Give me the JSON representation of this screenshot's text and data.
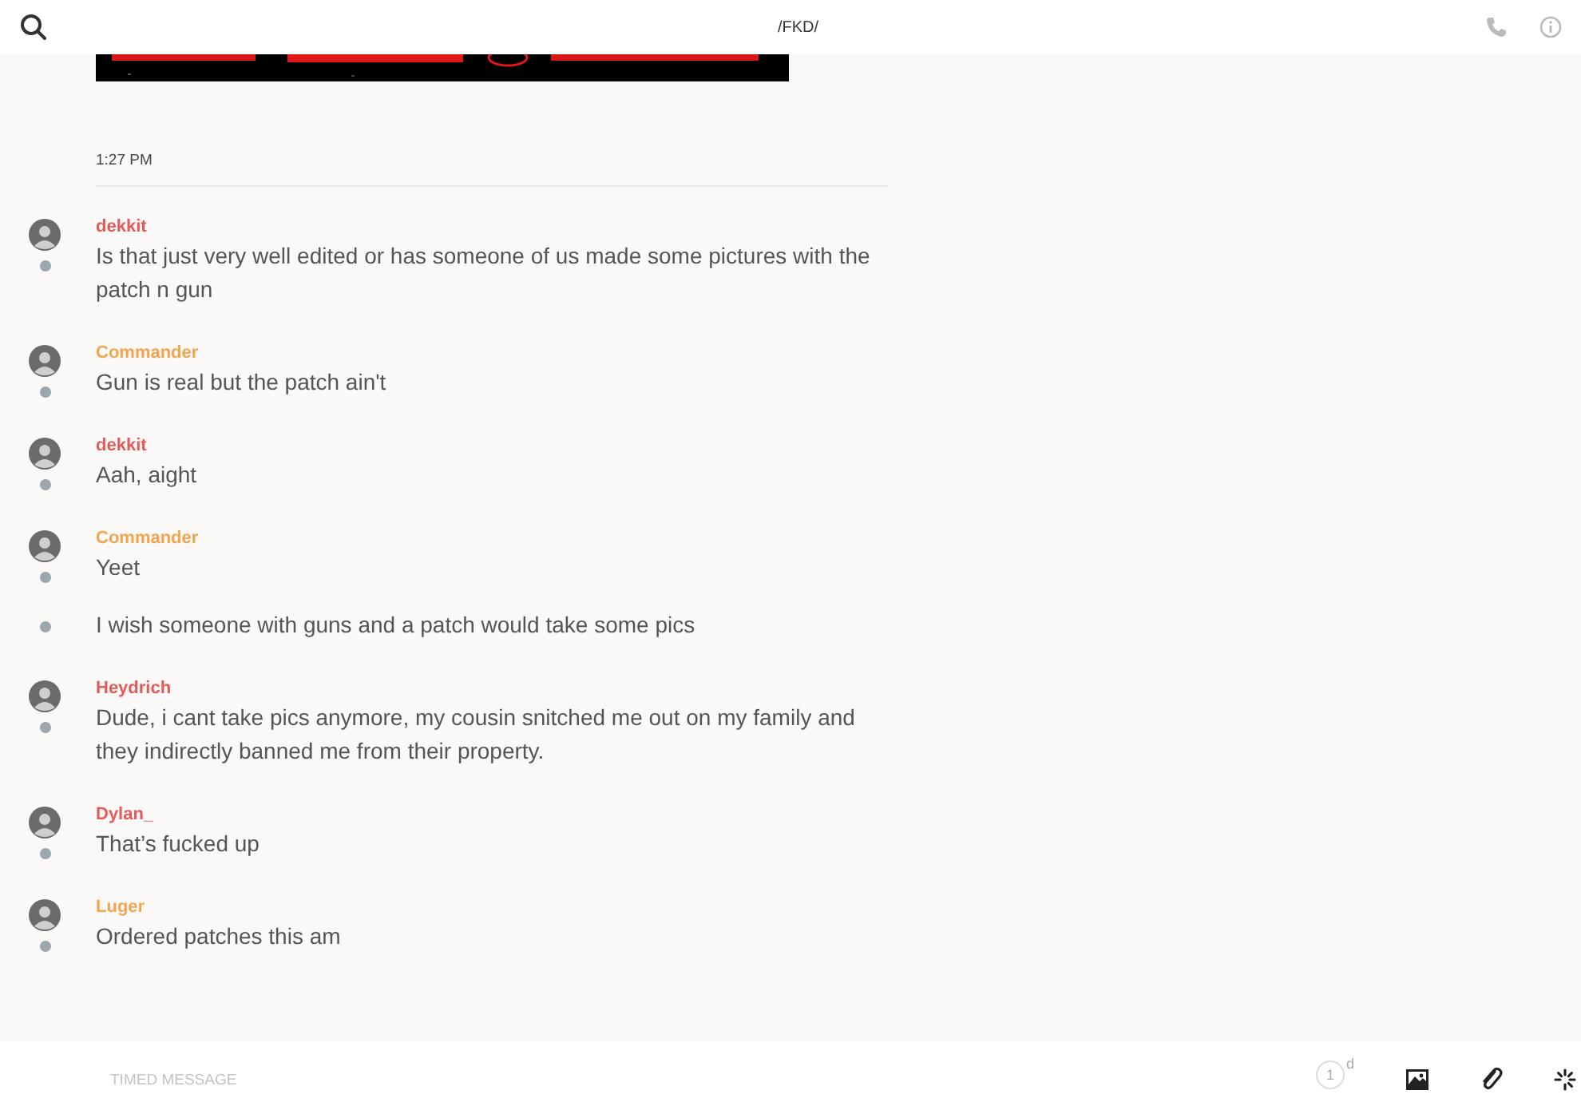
{
  "header": {
    "title": "/FKD/"
  },
  "timestamp": "1:27 PM",
  "messages": [
    {
      "author": "dekkit",
      "color": "#e25a5a",
      "text": "Is that just very well edited or has someone of us made some pictures with the patch n gun"
    },
    {
      "author": "Commander",
      "color": "#f2a54e",
      "text": "Gun is real but the patch ain't"
    },
    {
      "author": "dekkit",
      "color": "#e25a5a",
      "text": "Aah, aight"
    },
    {
      "author": "Commander",
      "color": "#f2a54e",
      "text": "Yeet"
    },
    {
      "text": "I wish someone with guns and a patch would take some pics"
    },
    {
      "author": "Heydrich",
      "color": "#e25a5a",
      "text": "Dude, i cant take pics anymore, my cousin snitched me out on my family and they indirectly banned me from their property."
    },
    {
      "author": "Dylan_",
      "color": "#e25a5a",
      "text": "That’s fucked up"
    },
    {
      "author": "Luger",
      "color": "#f2a54e",
      "text": "Ordered patches this am"
    }
  ],
  "composer": {
    "placeholder": "TIMED MESSAGE",
    "timer": {
      "value": "1",
      "unit": "d"
    }
  }
}
